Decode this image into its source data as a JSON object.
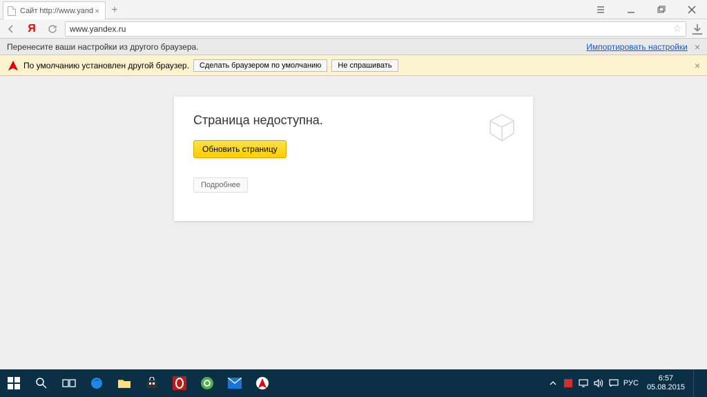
{
  "tab": {
    "title": "Сайт http://www.yand"
  },
  "addressbar": {
    "url": "www.yandex.ru"
  },
  "importbar": {
    "text": "Перенесите ваши настройки из другого браузера.",
    "link": "Импортировать настройки"
  },
  "yellowbar": {
    "text": "По умолчанию установлен другой браузер.",
    "set_default": "Сделать браузером по умолчанию",
    "dont_ask": "Не спрашивать"
  },
  "error_card": {
    "title": "Страница недоступна.",
    "refresh": "Обновить страницу",
    "more": "Подробнее"
  },
  "tray": {
    "lang": "РУС",
    "time": "6:57",
    "date": "05.08.2015"
  },
  "yandex_y": "Я"
}
